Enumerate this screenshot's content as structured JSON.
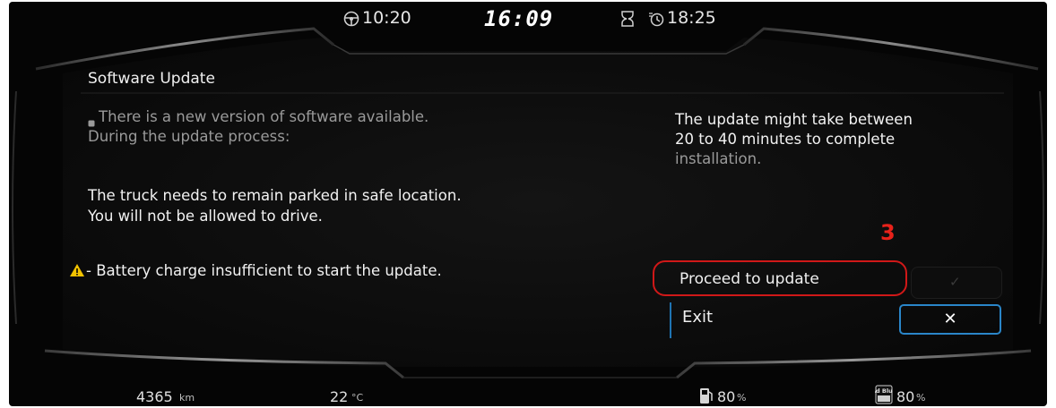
{
  "top_bar": {
    "drive_time": "10:20",
    "clock": "16:09",
    "rest_time": "18:25"
  },
  "dialog": {
    "title": "Software Update",
    "intro_line1": "There is a new version of software available.",
    "intro_line2": "During the update process:",
    "parked_line1": "The truck needs to remain parked in safe location.",
    "parked_line2": "You will not be allowed to drive.",
    "warning": "- Battery charge  insufficient to start the update.",
    "duration_line1": "The update might take between",
    "duration_line2": "20 to 40 minutes to complete",
    "duration_line3": "installation.",
    "proceed_label": "Proceed to update",
    "check_glyph": "✓",
    "exit_label": "Exit",
    "close_glyph": "✕",
    "annotation_number": "3"
  },
  "bottom_bar": {
    "odometer": "4365",
    "odometer_unit": "km",
    "temperature": "22",
    "temperature_unit": "°C",
    "fuel_level": "80",
    "fuel_unit": "%",
    "adblue_level": "80",
    "adblue_unit": "%",
    "adblue_icon_text": "Ad Blue"
  },
  "colors": {
    "background": "#050505",
    "annotation_red": "#d01818",
    "selection_blue": "#2a86c9",
    "warning_yellow": "#f2c200"
  },
  "icons": {
    "drive_time": "steering-wheel-icon",
    "break_time": "hourglass-icon",
    "rest_time": "rest-clock-icon",
    "warning": "warning-triangle-icon",
    "fuel": "fuel-pump-icon",
    "adblue": "adblue-icon"
  }
}
